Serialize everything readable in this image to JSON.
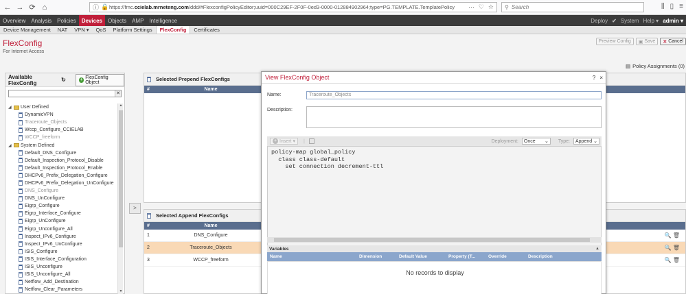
{
  "browser": {
    "url_prefix": "https://fmc.",
    "url_domain": "ccielab.mrneteng.com",
    "url_rest": "/ddd/#FlexconfigPolicyEditor;uuid=000C29EF-2F0F-0ed3-0000-012884902964;type=PG.TEMPLATE.TemplatePolicy",
    "search_placeholder": "Search",
    "more_glyph": "···"
  },
  "fmc_nav": {
    "items": [
      "Overview",
      "Analysis",
      "Policies",
      "Devices",
      "Objects",
      "AMP",
      "Intelligence"
    ],
    "active": "Devices",
    "deploy": "Deploy",
    "system": "System",
    "help": "Help ▾",
    "user": "admin ▾"
  },
  "sub_nav": {
    "items": [
      "Device Management",
      "NAT",
      "VPN ▾",
      "QoS",
      "Platform Settings",
      "FlexConfig",
      "Certificates"
    ],
    "active": "FlexConfig"
  },
  "page": {
    "title": "FlexConfig",
    "subtitle": "For Internet Access",
    "preview_btn": "Preview Config",
    "save_btn": "Save",
    "cancel_btn": "Cancel",
    "policy_assignments": "Policy Assignments (0)"
  },
  "left_panel": {
    "title": "Available FlexConfig",
    "add_btn": "FlexConfig Object",
    "tree": [
      {
        "type": "folder",
        "label": "User Defined"
      },
      {
        "type": "leaf",
        "label": "DynamicVPN",
        "dim": false
      },
      {
        "type": "leaf",
        "label": "Traceroute_Objects",
        "dim": true
      },
      {
        "type": "leaf",
        "label": "Wccp_Configure_CCIELAB",
        "dim": false
      },
      {
        "type": "leaf",
        "label": "WCCP_freeform",
        "dim": true
      },
      {
        "type": "folder",
        "label": "System Defined"
      },
      {
        "type": "leaf",
        "label": "Default_DNS_Configure",
        "dim": false
      },
      {
        "type": "leaf",
        "label": "Default_Inspection_Protocol_Disable",
        "dim": false
      },
      {
        "type": "leaf",
        "label": "Default_Inspection_Protocol_Enable",
        "dim": false
      },
      {
        "type": "leaf",
        "label": "DHCPv6_Prefix_Delegation_Configure",
        "dim": false
      },
      {
        "type": "leaf",
        "label": "DHCPv6_Prefix_Delegation_UnConfigure",
        "dim": false
      },
      {
        "type": "leaf",
        "label": "DNS_Configure",
        "dim": true
      },
      {
        "type": "leaf",
        "label": "DNS_UnConfigure",
        "dim": false
      },
      {
        "type": "leaf",
        "label": "Eigrp_Configure",
        "dim": false
      },
      {
        "type": "leaf",
        "label": "Eigrp_Interface_Configure",
        "dim": false
      },
      {
        "type": "leaf",
        "label": "Eigrp_UnConfigure",
        "dim": false
      },
      {
        "type": "leaf",
        "label": "Eigrp_Unconfigure_All",
        "dim": false
      },
      {
        "type": "leaf",
        "label": "Inspect_IPv6_Configure",
        "dim": false
      },
      {
        "type": "leaf",
        "label": "Inspect_IPv6_UnConfigure",
        "dim": false
      },
      {
        "type": "leaf",
        "label": "ISIS_Configure",
        "dim": false
      },
      {
        "type": "leaf",
        "label": "ISIS_Interface_Configuration",
        "dim": false
      },
      {
        "type": "leaf",
        "label": "ISIS_Unconfigure",
        "dim": false
      },
      {
        "type": "leaf",
        "label": "ISIS_Unconfigure_All",
        "dim": false
      },
      {
        "type": "leaf",
        "label": "Netflow_Add_Destination",
        "dim": false
      },
      {
        "type": "leaf",
        "label": "Netflow_Clear_Parameters",
        "dim": false
      }
    ]
  },
  "prepend": {
    "title": "Selected Prepend FlexConfigs",
    "col_hash": "#",
    "col_name": "Name"
  },
  "append": {
    "title": "Selected Append FlexConfigs",
    "col_hash": "#",
    "col_name": "Name",
    "rows": [
      {
        "num": "1",
        "name": "DNS_Configure"
      },
      {
        "num": "2",
        "name": "Traceroute_Objects"
      },
      {
        "num": "3",
        "name": "WCCP_freeform"
      }
    ]
  },
  "modal": {
    "title": "View FlexConfig Object",
    "help": "?",
    "close": "×",
    "name_label": "Name:",
    "name_value": "Traceroute_Objects",
    "desc_label": "Description:",
    "insert_btn": "Insert ▾",
    "deployment_label": "Deployment:",
    "deployment_value": "Once",
    "type_label": "Type:",
    "type_value": "Append",
    "code_lines": [
      "policy-map global_policy",
      "  class class-default",
      "    set connection decrement-ttl"
    ],
    "variables_label": "Variables",
    "var_cols": [
      "Name",
      "Dimension",
      "Default Value",
      "Property (T...",
      "Override",
      "Description"
    ],
    "no_records": "No records to display"
  }
}
